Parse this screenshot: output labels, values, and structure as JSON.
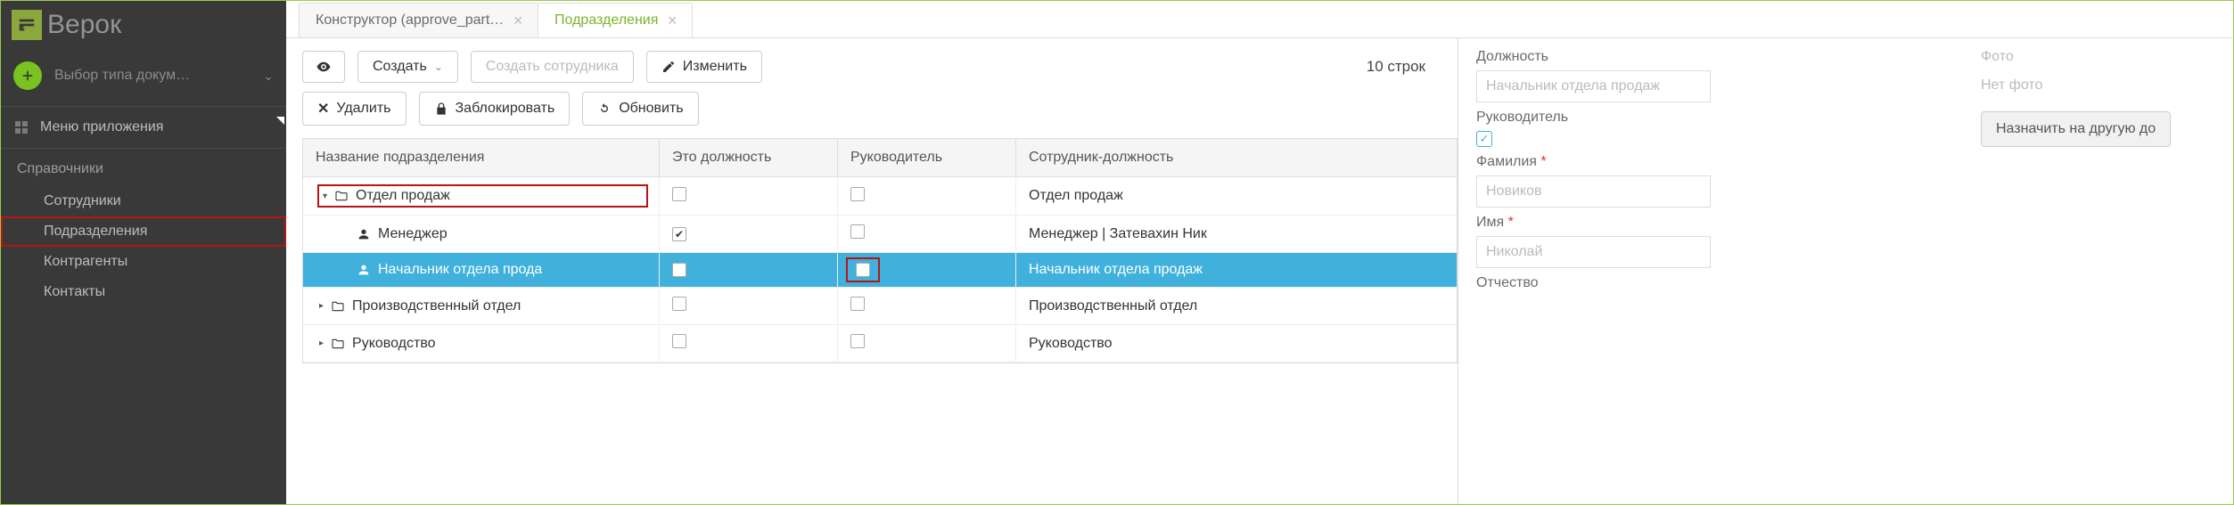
{
  "brand": "Верок",
  "sidebar": {
    "doc_type_placeholder": "Выбор типа докум…",
    "menu_app": "Меню приложения",
    "references_header": "Справочники",
    "items": [
      {
        "label": "Сотрудники"
      },
      {
        "label": "Подразделения"
      },
      {
        "label": "Контрагенты"
      },
      {
        "label": "Контакты"
      }
    ]
  },
  "tabs": [
    {
      "label": "Конструктор (approve_part…",
      "active": false
    },
    {
      "label": "Подразделения",
      "active": true
    }
  ],
  "toolbar": {
    "create": "Создать",
    "create_employee": "Создать сотрудника",
    "edit": "Изменить",
    "delete": "Удалить",
    "lock": "Заблокировать",
    "refresh": "Обновить",
    "row_count": "10 строк"
  },
  "columns": [
    "Название подразделения",
    "Это должность",
    "Руководитель",
    "Сотрудник-должность"
  ],
  "rows": [
    {
      "indent": 1,
      "caret": "▾",
      "icon": "folder",
      "name": "Отдел продаж",
      "is_pos": false,
      "is_head": false,
      "emp": "Отдел продаж",
      "outline_name": true,
      "selected": false
    },
    {
      "indent": 2,
      "caret": "",
      "icon": "user",
      "name": "Менеджер",
      "is_pos": true,
      "is_head": false,
      "emp": "Менеджер | Затевахин Ник",
      "selected": false
    },
    {
      "indent": 2,
      "caret": "",
      "icon": "user",
      "name": "Начальник отдела прода",
      "is_pos": true,
      "is_head": true,
      "emp": "Начальник отдела продаж",
      "selected": true,
      "outline_head": true
    },
    {
      "indent": 1,
      "caret": "▸",
      "icon": "folder",
      "name": "Производственный отдел",
      "is_pos": false,
      "is_head": false,
      "emp": "Производственный отдел",
      "selected": false
    },
    {
      "indent": 1,
      "caret": "▸",
      "icon": "folder",
      "name": "Руководство",
      "is_pos": false,
      "is_head": false,
      "emp": "Руководство",
      "selected": false
    }
  ],
  "inspector": {
    "position_label": "Должность",
    "position_value": "Начальник отдела продаж",
    "photo_label": "Фото",
    "photo_value": "Нет фото",
    "head_label": "Руководитель",
    "assign_btn": "Назначить на другую до",
    "surname_label": "Фамилия",
    "surname_value": "Новиков",
    "name_label": "Имя",
    "name_value": "Николай",
    "patronymic_label": "Отчество"
  }
}
